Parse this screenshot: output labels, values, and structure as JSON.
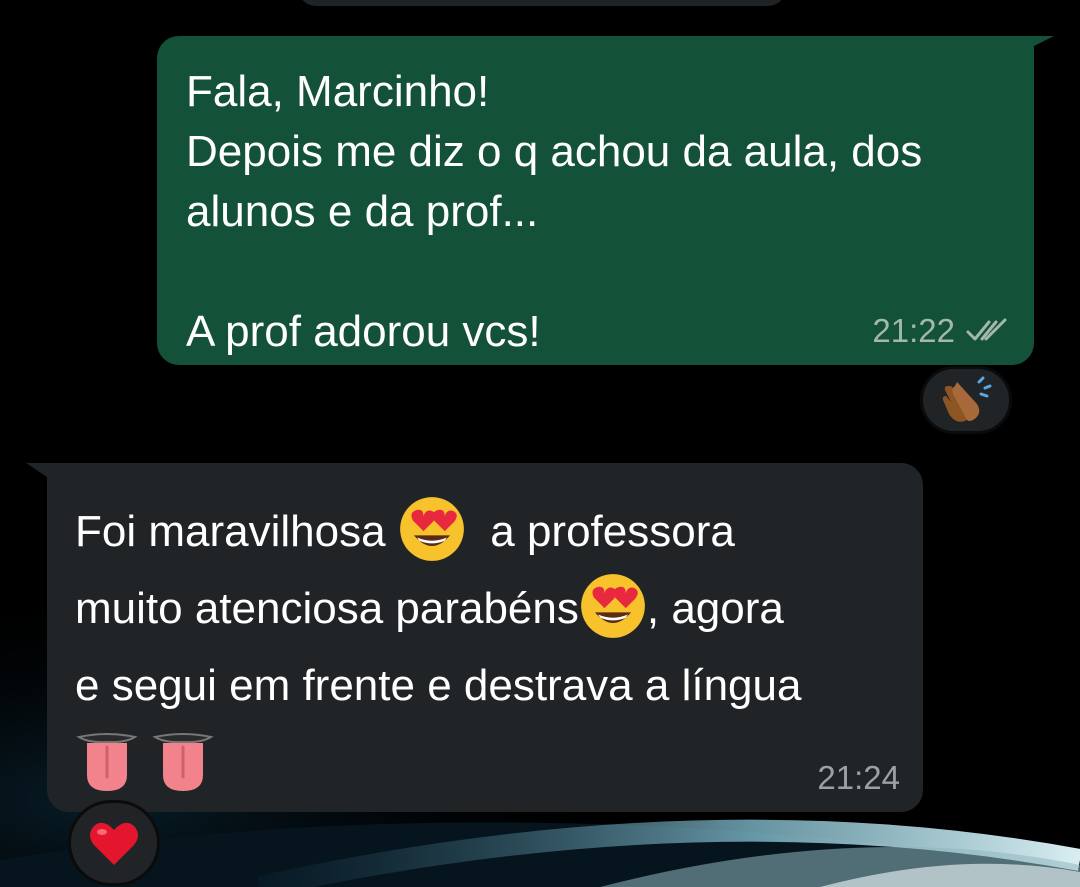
{
  "outgoing_message": {
    "lines": [
      "Fala, Marcinho!",
      "Depois me diz o q achou da aula, dos",
      "alunos e da prof...",
      "",
      "A prof adorou vcs!"
    ],
    "time": "21:22",
    "status_icon": "double-check-icon",
    "reaction": "clapping-hands-emoji"
  },
  "incoming_message": {
    "line1_a": "Foi maravilhosa",
    "line1_b": "a professora",
    "line2_a": "muito atenciosa parabéns",
    "line2_b": ", agora",
    "line3": "e segui em frente e destrava a língua",
    "emojis": [
      "smiling-face-with-heart-eyes",
      "smiling-face-with-heart-eyes",
      "tongue",
      "tongue"
    ],
    "time": "21:24",
    "reaction": "red-heart-emoji"
  },
  "colors": {
    "background": "#000000",
    "outgoing_bubble": "#135138",
    "incoming_bubble": "#202427",
    "text": "#ffffff",
    "timestamp": "#a3b7ac"
  }
}
